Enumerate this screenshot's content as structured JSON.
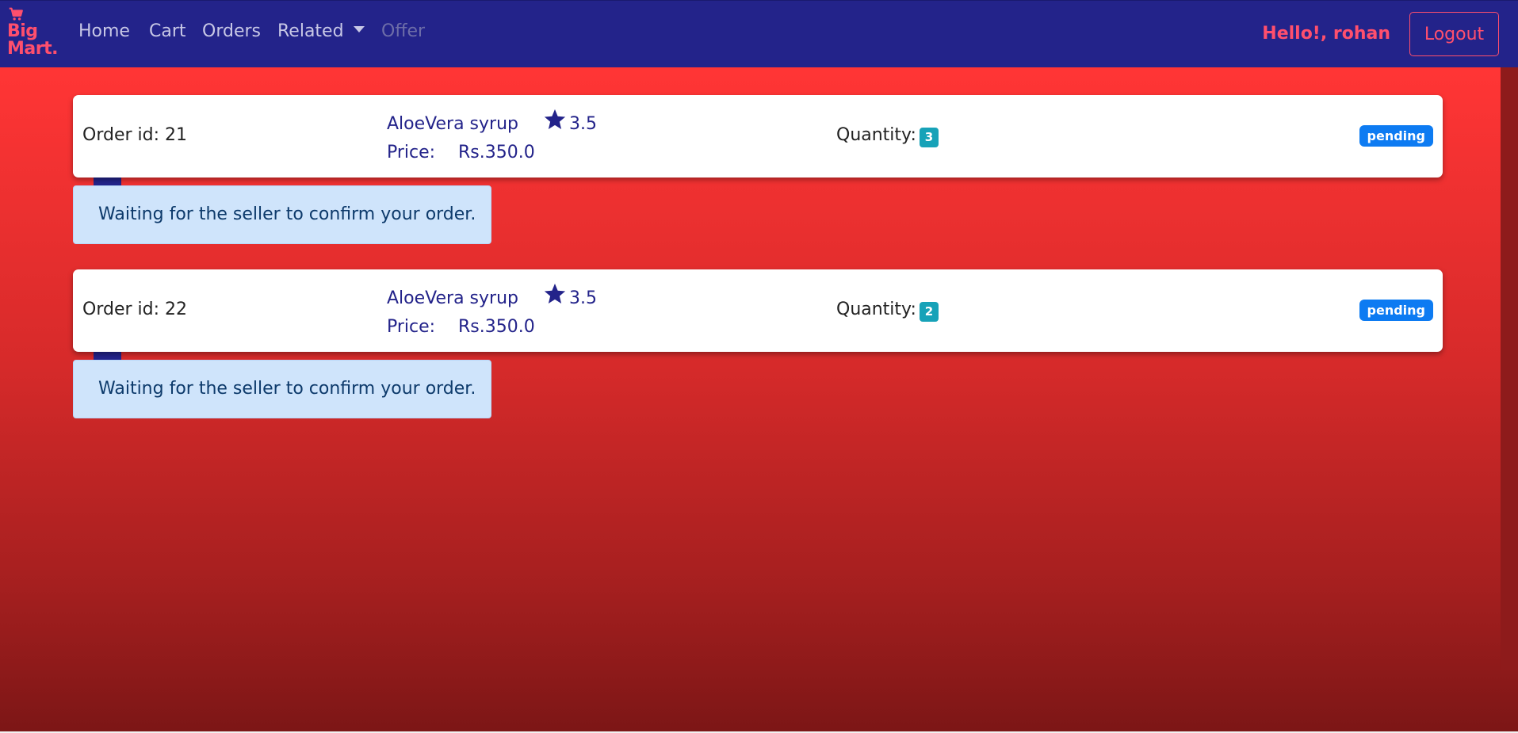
{
  "navbar": {
    "brand": {
      "icon": "cart-icon",
      "line1": "Big",
      "line2": "Mart."
    },
    "links": [
      {
        "label": "Home"
      },
      {
        "label": "Cart"
      },
      {
        "label": "Orders"
      },
      {
        "label": "Related"
      },
      {
        "label": "Offer"
      }
    ],
    "greeting": "Hello!, rohan",
    "logout_label": "Logout"
  },
  "orders": [
    {
      "order_id_text": "Order id: 21",
      "product_name": "AloeVera syrup",
      "rating_icon": "star-icon",
      "rating": "3.5",
      "price_label": "Price:",
      "price": "Rs.350.0",
      "quantity_label": "Quantity:",
      "quantity": "3",
      "status": "pending",
      "message": "Waiting for the seller to confirm your order."
    },
    {
      "order_id_text": "Order id: 22",
      "product_name": "AloeVera syrup",
      "rating_icon": "star-icon",
      "rating": "3.5",
      "price_label": "Price:",
      "price": "Rs.350.0",
      "quantity_label": "Quantity:",
      "quantity": "2",
      "status": "pending",
      "message": "Waiting for the seller to confirm your order."
    }
  ],
  "colors": {
    "navbar_bg": "#23238a",
    "brand_accent": "#ff4f6d",
    "quantity_badge": "#17a2b8",
    "status_badge": "#0d7bf2",
    "alert_bg": "#cfe4fb"
  }
}
